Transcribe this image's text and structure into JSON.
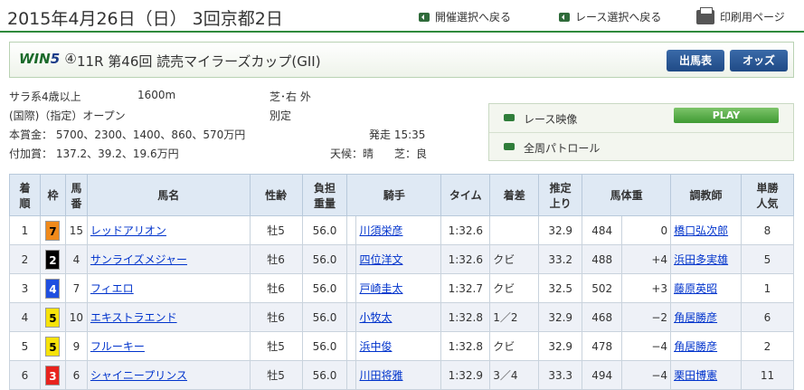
{
  "header": {
    "date": "2015年4月26日（日） 3回京都2日",
    "links": [
      "開催選択へ戻る",
      "レース選択へ戻る",
      "印刷用ページ"
    ]
  },
  "race": {
    "logo_win": "WIN",
    "logo_five": "5",
    "logo_leg": "④",
    "title": "11R  第46回  読売マイラーズカップ(GII)",
    "buttons": [
      "出馬表",
      "オッズ"
    ]
  },
  "info": {
    "line1_a": "サラ系4歳以上",
    "line1_b": "1600m",
    "line1_c": "芝･右  外",
    "line2_a": "(国際)（指定）オープン",
    "line2_c": "別定",
    "line3": "本賞金：  5700、2300、1400、860、570万円",
    "start": "発走 15:35",
    "line4": "付加賞：  137.2、39.2、19.6万円",
    "weather": "天候：晴",
    "track": "芝：良"
  },
  "video": {
    "race_video": "レース映像",
    "play": "PLAY",
    "patrol": "全周パトロール"
  },
  "table": {
    "headers": [
      {
        "a": "着",
        "b": "順"
      },
      {
        "a": "枠",
        "b": ""
      },
      {
        "a": "馬",
        "b": "番"
      },
      {
        "a": "馬名",
        "b": ""
      },
      {
        "a": "性齢",
        "b": ""
      },
      {
        "a": "負担",
        "b": "重量"
      },
      {
        "a": "騎手",
        "b": ""
      },
      {
        "a": "タイム",
        "b": ""
      },
      {
        "a": "着差",
        "b": ""
      },
      {
        "a": "推定",
        "b": "上り"
      },
      {
        "a": "馬体重",
        "b": ""
      },
      {
        "a": "調教師",
        "b": ""
      },
      {
        "a": "単勝",
        "b": "人気"
      }
    ],
    "rows": [
      {
        "rank": "1",
        "waku": "7",
        "num": "15",
        "horse": "レッドアリオン",
        "sex": "牡5",
        "weight": "56.0",
        "jockey": "川須栄彦",
        "time": "1:32.6",
        "margin": "",
        "last": "32.9",
        "bw": "484",
        "diff": "0",
        "trainer": "橋口弘次郎",
        "pop": "8"
      },
      {
        "rank": "2",
        "waku": "2",
        "num": "4",
        "horse": "サンライズメジャー",
        "sex": "牡6",
        "weight": "56.0",
        "jockey": "四位洋文",
        "time": "1:32.6",
        "margin": "クビ",
        "last": "33.2",
        "bw": "488",
        "diff": "+4",
        "trainer": "浜田多実雄",
        "pop": "5"
      },
      {
        "rank": "3",
        "waku": "4",
        "num": "7",
        "horse": "フィエロ",
        "sex": "牡6",
        "weight": "56.0",
        "jockey": "戸崎圭太",
        "time": "1:32.7",
        "margin": "クビ",
        "last": "32.5",
        "bw": "502",
        "diff": "+3",
        "trainer": "藤原英昭",
        "pop": "1"
      },
      {
        "rank": "4",
        "waku": "5",
        "num": "10",
        "horse": "エキストラエンド",
        "sex": "牡6",
        "weight": "56.0",
        "jockey": "小牧太",
        "time": "1:32.8",
        "margin": "1／2",
        "last": "32.9",
        "bw": "468",
        "diff": "−2",
        "trainer": "角居勝彦",
        "pop": "6"
      },
      {
        "rank": "5",
        "waku": "5",
        "num": "9",
        "horse": "フルーキー",
        "sex": "牡5",
        "weight": "56.0",
        "jockey": "浜中俊",
        "time": "1:32.8",
        "margin": "クビ",
        "last": "32.9",
        "bw": "478",
        "diff": "−4",
        "trainer": "角居勝彦",
        "pop": "2"
      },
      {
        "rank": "6",
        "waku": "3",
        "num": "6",
        "horse": "シャイニープリンス",
        "sex": "牡5",
        "weight": "56.0",
        "jockey": "川田将雅",
        "time": "1:32.9",
        "margin": "3／4",
        "last": "33.3",
        "bw": "494",
        "diff": "−4",
        "trainer": "栗田博憲",
        "pop": "11"
      }
    ]
  },
  "colors": {
    "accent_green": "#2f8a3c",
    "header_blue": "#dfe9f4",
    "waku": {
      "1": "#ffffff",
      "2": "#000000",
      "3": "#e8231e",
      "4": "#1f4fe0",
      "5": "#f6e20a",
      "6": "#20a040",
      "7": "#f08a1b",
      "8": "#f3a0c0"
    }
  }
}
